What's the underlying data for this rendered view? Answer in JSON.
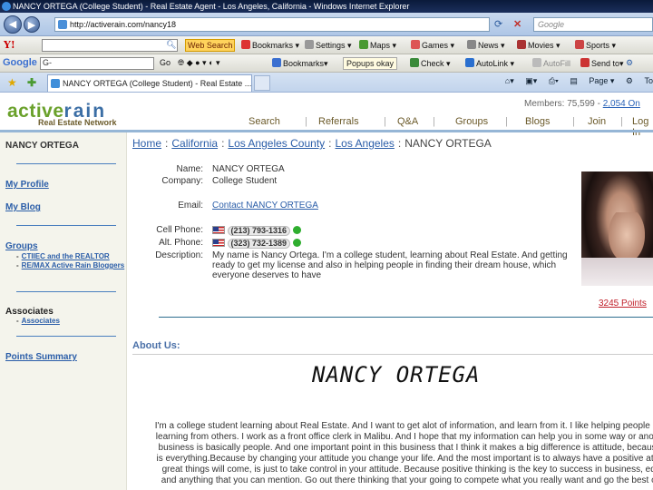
{
  "window": {
    "title": "NANCY ORTEGA (College Student) - Real Estate Agent - Los Angeles, California - Windows Internet Explorer"
  },
  "address_bar": {
    "url": "http://activerain.com/nancy18",
    "search_placeholder": "Google"
  },
  "yahoo_toolbar": {
    "logo": "Y!",
    "web_search": "Web Search",
    "items": [
      "Bookmarks",
      "Settings",
      "Maps",
      "Games",
      "News",
      "Movies",
      "Sports"
    ]
  },
  "google_toolbar": {
    "logo": "Google",
    "input_value": "G-",
    "go": "Go",
    "bookmarks": "Bookmarks",
    "popups": "Popups okay",
    "check": "Check",
    "autolink": "AutoLink",
    "autofill": "AutoFill",
    "send_to": "Send to"
  },
  "tabs": {
    "active_label": "NANCY ORTEGA (College Student) - Real Estate ...",
    "command_bar": [
      "Page",
      "To"
    ]
  },
  "site": {
    "logo_active": "active",
    "logo_rain": "rain",
    "logo_sub": "Real Estate Network",
    "members_label": "Members: 75,599 - ",
    "members_link": "2,054 On",
    "nav": [
      "Search",
      "Referrals",
      "Q&A",
      "Groups",
      "Blogs",
      "Join",
      "Log In"
    ]
  },
  "sidebar": {
    "name": "NANCY ORTEGA",
    "my_profile": "My Profile",
    "my_blog": "My Blog",
    "groups_title": "Groups",
    "groups": [
      "CTIIEC and the REALTOR",
      "RE/MAX Active Rain Bloggers"
    ],
    "associates_title": "Associates",
    "associates_link": "Associates",
    "points_summary": "Points Summary"
  },
  "breadcrumb": {
    "home": "Home",
    "state": "California",
    "county": "Los Angeles County",
    "city": "Los Angeles",
    "current": "NANCY ORTEGA"
  },
  "profile": {
    "name_label": "Name:",
    "name": "NANCY ORTEGA",
    "company_label": "Company:",
    "company": "College Student",
    "email_label": "Email:",
    "email_link": "Contact NANCY ORTEGA",
    "cell_label": "Cell Phone:",
    "cell": "(213) 793-1316",
    "alt_label": "Alt. Phone:",
    "alt": "(323) 732-1389",
    "description_label": "Description:",
    "description": "My name is Nancy Ortega. I'm a college student, learning about Real Estate. And getting ready to get my license and also in helping people in finding their dream house, which everyone deserves to have",
    "points": "3245 Points"
  },
  "about": {
    "title": "About Us:",
    "headline": "NANCY ORTEGA",
    "lines": [
      "I'm a college student learning about Real Estate. And I want to get alot of information, and learn from it. I like helping people and i",
      "learning from others. I work as a front office clerk in Malibu. And I hope that my information can help you in some way or another.",
      "business is basically people. And one important point in this business that I think it makes a big difference is attitude, because a",
      "is everything.Because by changing your attitude you change your life. And the most important is to always have a positive attitud",
      "great things will come, is just to take control in your attitude. Because positive thinking is the key to success in business, educ",
      "and anything that you can mention. Go out there thinking that your going to compete what you really want and go the best of y"
    ]
  }
}
